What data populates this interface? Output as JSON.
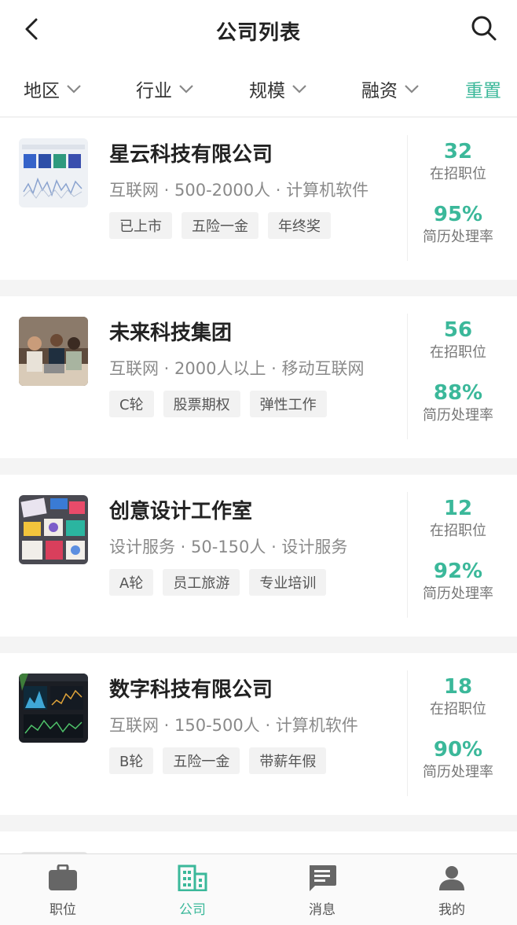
{
  "header": {
    "title": "公司列表",
    "back_icon": "chevron-left-icon",
    "search_icon": "search-icon"
  },
  "filters": {
    "items": [
      {
        "label": "地区"
      },
      {
        "label": "行业"
      },
      {
        "label": "规模"
      },
      {
        "label": "融资"
      }
    ],
    "reset_label": "重置",
    "accent": "#3bb89a"
  },
  "companies": [
    {
      "name": "星云科技有限公司",
      "meta": "互联网 · 500-2000人 · 计算机软件",
      "tags": [
        "已上市",
        "五险一金",
        "年终奖"
      ],
      "jobs": "32",
      "jobs_label": "在招职位",
      "rate": "95%",
      "rate_label": "简历处理率"
    },
    {
      "name": "未来科技集团",
      "meta": "互联网 · 2000人以上 · 移动互联网",
      "tags": [
        "C轮",
        "股票期权",
        "弹性工作"
      ],
      "jobs": "56",
      "jobs_label": "在招职位",
      "rate": "88%",
      "rate_label": "简历处理率"
    },
    {
      "name": "创意设计工作室",
      "meta": "设计服务 · 50-150人 · 设计服务",
      "tags": [
        "A轮",
        "员工旅游",
        "专业培训"
      ],
      "jobs": "12",
      "jobs_label": "在招职位",
      "rate": "92%",
      "rate_label": "简历处理率"
    },
    {
      "name": "数字科技有限公司",
      "meta": "互联网 · 150-500人 · 计算机软件",
      "tags": [
        "B轮",
        "五险一金",
        "带薪年假"
      ],
      "jobs": "18",
      "jobs_label": "在招职位",
      "rate": "90%",
      "rate_label": "简历处理率"
    }
  ],
  "tabbar": {
    "items": [
      {
        "label": "职位",
        "icon": "briefcase-icon"
      },
      {
        "label": "公司",
        "icon": "building-icon",
        "active": true
      },
      {
        "label": "消息",
        "icon": "message-icon"
      },
      {
        "label": "我的",
        "icon": "person-icon"
      }
    ]
  }
}
